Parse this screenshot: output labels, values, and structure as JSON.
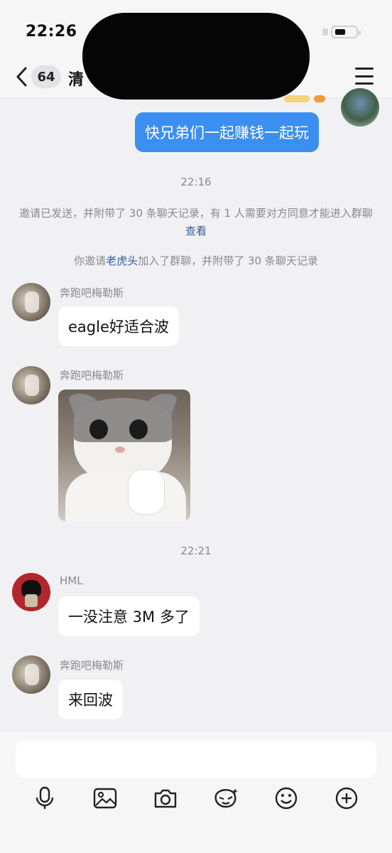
{
  "status_bar": {
    "time": "22:26"
  },
  "header": {
    "unread_count": "64",
    "chat_title": "清"
  },
  "messages": {
    "me_text": "快兄弟们一起赚钱一起玩",
    "time1": "22:16",
    "invite_notice": "邀请已发送，并附带了 30 条聊天记录，有 1 人需要对方同意才能进入群聊",
    "invite_link": "查看",
    "join_notice_prefix": "你邀请",
    "join_notice_name": "老虎头",
    "join_notice_suffix": "加入了群聊，并附带了 30 条聊天记录",
    "m1_sender": "奔跑吧梅勒斯",
    "m1_text": "eagle好适合波",
    "m2_sender": "奔跑吧梅勒斯",
    "time2": "22:21",
    "m3_sender": "HML",
    "m3_text": "一没注意 3M 多了",
    "m4_sender": "奔跑吧梅勒斯",
    "m4_text": "来回波"
  },
  "toolbar": {
    "icons": [
      "microphone-icon",
      "image-icon",
      "camera-icon",
      "sticker-icon",
      "emoji-icon",
      "plus-icon"
    ]
  },
  "colors": {
    "accent": "#3a8ff0",
    "background": "#f1f1f3",
    "link": "#355a9a"
  }
}
